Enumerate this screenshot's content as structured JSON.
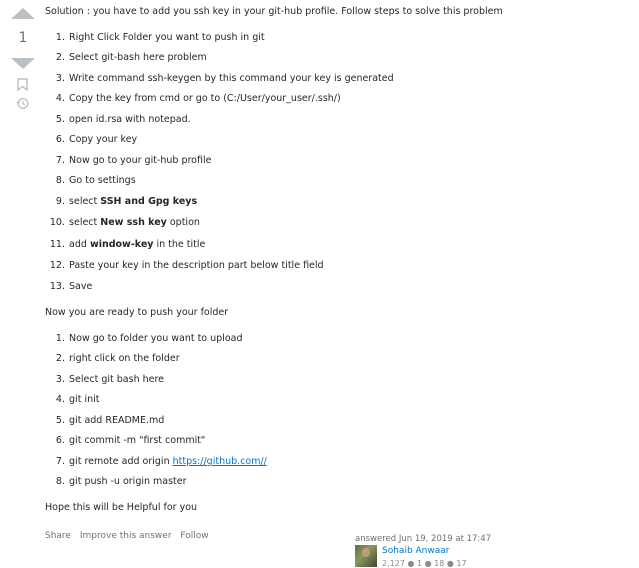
{
  "vote": {
    "count": "1"
  },
  "intro": "Solution : you have to add you ssh key in your git-hub profile. Follow steps to solve this problem",
  "steps1": [
    {
      "n": "1.",
      "text": "Right Click Folder you want to push in git"
    },
    {
      "n": "2.",
      "text": "Select git-bash here problem"
    },
    {
      "n": "3.",
      "text": "Write command ssh-keygen by this command your key is generated"
    },
    {
      "n": "4.",
      "text": "Copy the key from cmd or go to (C:/User/your_user/.ssh/)"
    },
    {
      "n": "5.",
      "text": "open id.rsa with notepad."
    },
    {
      "n": "6.",
      "text": "Copy your key"
    },
    {
      "n": "7.",
      "text": "Now go to your git-hub profile"
    },
    {
      "n": "8.",
      "text": "Go to settings"
    },
    {
      "n": "9.",
      "pre": "select ",
      "bold": "SSH and Gpg keys",
      "post": ""
    },
    {
      "n": "10.",
      "pre": "select ",
      "bold": "New ssh key",
      "post": " option"
    },
    {
      "n": "11.",
      "pre": "add ",
      "bold": "window-key",
      "post": " in the title"
    },
    {
      "n": "12.",
      "text": "Paste your key in the description part below title field"
    },
    {
      "n": "13.",
      "text": "Save"
    }
  ],
  "middle": "Now you are ready to push your folder",
  "steps2": [
    {
      "n": "1.",
      "text": "Now go to folder you want to upload"
    },
    {
      "n": "2.",
      "text": "right click on the folder"
    },
    {
      "n": "3.",
      "text": "Select git bash here"
    },
    {
      "n": "4.",
      "text": "git init"
    },
    {
      "n": "5.",
      "text": "git add README.md"
    },
    {
      "n": "6.",
      "text": "git commit -m \"first commit\""
    },
    {
      "n": "7.",
      "pre": "git remote add origin ",
      "link": "https://github.com//"
    },
    {
      "n": "8.",
      "text": "git push -u origin master"
    }
  ],
  "outro": "Hope this will be Helpful for you",
  "menu": {
    "share": "Share",
    "improve": "Improve this answer",
    "follow": "Follow"
  },
  "signature": {
    "action": "answered Jun 19, 2019 at 17:47",
    "name": "Sohaib Anwaar",
    "rep": "2,127 ● 1 ● 18 ● 17"
  },
  "colors": {
    "link": "#0077cc",
    "vote_arrow": "#bbc0c4",
    "muted": "#6a737c"
  }
}
